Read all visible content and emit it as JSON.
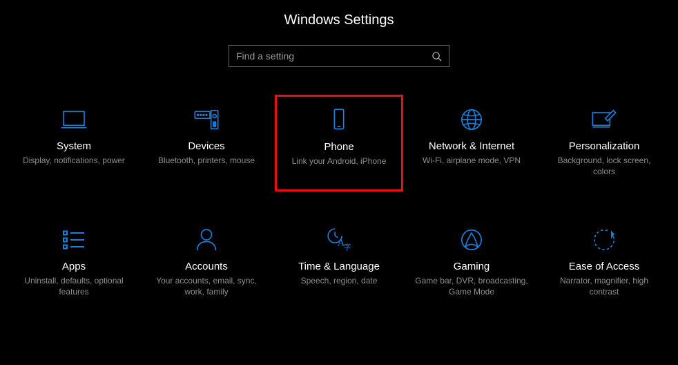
{
  "title": "Windows Settings",
  "search": {
    "placeholder": "Find a setting"
  },
  "highlighted_index": 2,
  "colors": {
    "accent": "#1c7edb",
    "highlight_border": "#ee0e0e"
  },
  "tiles": [
    {
      "name": "system",
      "title": "System",
      "desc": "Display, notifications, power"
    },
    {
      "name": "devices",
      "title": "Devices",
      "desc": "Bluetooth, printers, mouse"
    },
    {
      "name": "phone",
      "title": "Phone",
      "desc": "Link your Android, iPhone"
    },
    {
      "name": "network-internet",
      "title": "Network & Internet",
      "desc": "Wi-Fi, airplane mode, VPN"
    },
    {
      "name": "personalization",
      "title": "Personalization",
      "desc": "Background, lock screen, colors"
    },
    {
      "name": "apps",
      "title": "Apps",
      "desc": "Uninstall, defaults, optional features"
    },
    {
      "name": "accounts",
      "title": "Accounts",
      "desc": "Your accounts, email, sync, work, family"
    },
    {
      "name": "time-language",
      "title": "Time & Language",
      "desc": "Speech, region, date"
    },
    {
      "name": "gaming",
      "title": "Gaming",
      "desc": "Game bar, DVR, broadcasting, Game Mode"
    },
    {
      "name": "ease-of-access",
      "title": "Ease of Access",
      "desc": "Narrator, magnifier, high contrast"
    }
  ]
}
